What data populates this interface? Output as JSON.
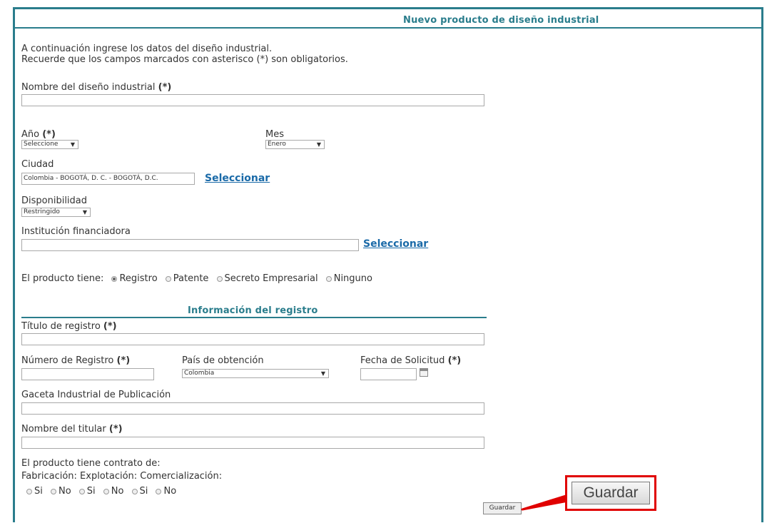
{
  "header": {
    "title": "Nuevo producto de diseño industrial"
  },
  "intro": {
    "line1": "A continuación ingrese los datos del diseño industrial.",
    "line2": "Recuerde que los campos marcados con asterisco (*) son obligatorios."
  },
  "required_mark": "(*)",
  "fields": {
    "nombre_label": "Nombre del diseño industrial",
    "nombre_value": "",
    "anio_label": "Año",
    "anio_value": "Seleccione",
    "mes_label": "Mes",
    "mes_value": "Enero",
    "ciudad_label": "Ciudad",
    "ciudad_value": "Colombia - BOGOTÁ, D. C. - BOGOTÁ, D.C.",
    "ciudad_link": "Seleccionar",
    "disponibilidad_label": "Disponibilidad",
    "disponibilidad_value": "Restringido",
    "institucion_label": "Institución financiadora",
    "institucion_value": "",
    "institucion_link": "Seleccionar"
  },
  "tipo": {
    "label": "El producto tiene:",
    "options": [
      "Registro",
      "Patente",
      "Secreto Empresarial",
      "Ninguno"
    ],
    "selected": "Registro"
  },
  "registro": {
    "section_title": "Información del registro",
    "titulo_label": "Título de registro",
    "titulo_value": "",
    "numero_label": "Número de Registro",
    "numero_value": "",
    "pais_label": "País de obtención",
    "pais_value": "Colombia",
    "fecha_label": "Fecha de Solicitud",
    "fecha_value": "",
    "gaceta_label": "Gaceta Industrial de Publicación",
    "gaceta_value": "",
    "titular_label": "Nombre del titular",
    "titular_value": ""
  },
  "contrato": {
    "label": "El producto tiene contrato de:",
    "types_line": "Fabricación: Explotación: Comercialización:",
    "yes": "Si",
    "no": "No"
  },
  "actions": {
    "save_label": "Guardar",
    "save_zoom_label": "Guardar"
  },
  "colors": {
    "accent": "#2a7d8c",
    "link": "#1a6aa8",
    "highlight": "#e00000"
  }
}
